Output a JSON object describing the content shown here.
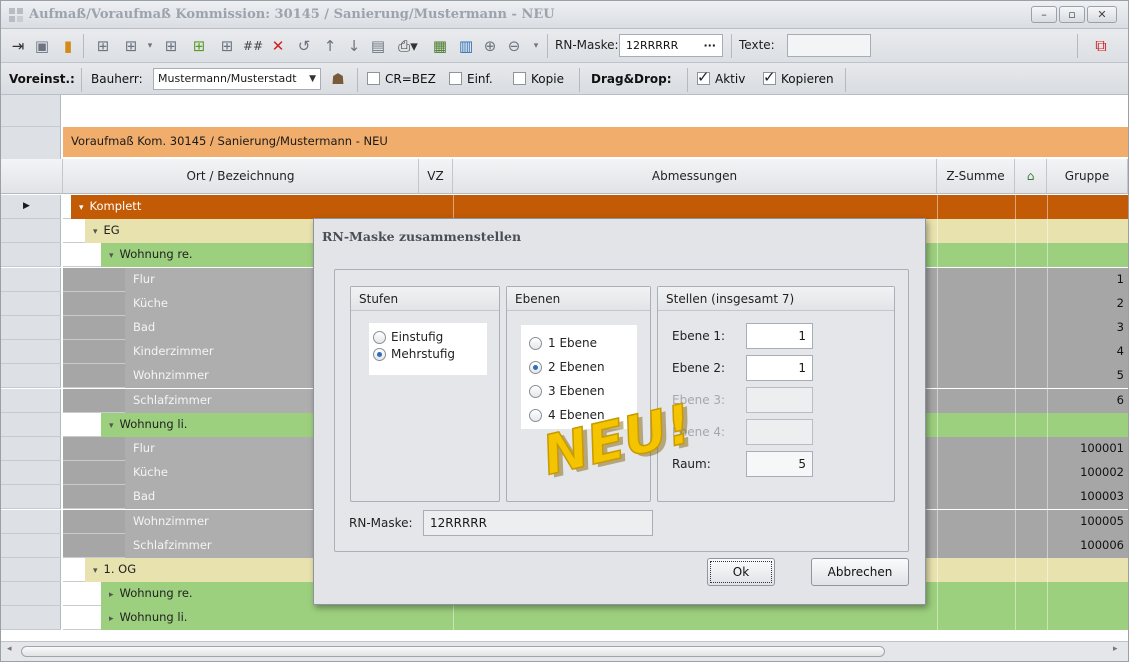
{
  "window": {
    "title": "Aufmaß/Voraufmaß Kommission: 30145 / Sanierung/Mustermann - NEU",
    "min": "–",
    "max": "▫",
    "close": "✕"
  },
  "toolbar": {
    "rn_label": "RN-Maske:",
    "rn_value": "12RRRRR",
    "rn_ellipsis": "···",
    "texte_label": "Texte:",
    "hash": "##"
  },
  "options": {
    "voreinst": "Voreinst.:",
    "bauherr_label": "Bauherr:",
    "bauherr_value": "Mustermann/Musterstadt",
    "cr_bez": "CR=BEZ",
    "einf": "Einf.",
    "kopie": "Kopie",
    "dragdrop": "Drag&Drop:",
    "aktiv": "Aktiv",
    "kopieren": "Kopieren"
  },
  "grid": {
    "caption": "Voraufmaß Kom. 30145 / Sanierung/Mustermann - NEU",
    "headers": {
      "ort": "Ort / Bezeichnung",
      "vz": "VZ",
      "abm": "Abmessungen",
      "zsum": "Z-Summe",
      "gruppe": "Gruppe"
    },
    "rows": [
      {
        "label": "Komplett",
        "exp": "▾",
        "gruppe": ""
      },
      {
        "label": "EG",
        "exp": "▾",
        "gruppe": ""
      },
      {
        "label": "Wohnung re.",
        "exp": "▾",
        "gruppe": ""
      },
      {
        "label": "Flur",
        "exp": "",
        "gruppe": "1"
      },
      {
        "label": "Küche",
        "exp": "",
        "gruppe": "2"
      },
      {
        "label": "Bad",
        "exp": "",
        "gruppe": "3"
      },
      {
        "label": "Kinderzimmer",
        "exp": "",
        "gruppe": "4"
      },
      {
        "label": "Wohnzimmer",
        "exp": "",
        "gruppe": "5"
      },
      {
        "label": "Schlafzimmer",
        "exp": "",
        "gruppe": "6"
      },
      {
        "label": "Wohnung li.",
        "exp": "▾",
        "gruppe": ""
      },
      {
        "label": "Flur",
        "exp": "",
        "gruppe": "100001"
      },
      {
        "label": "Küche",
        "exp": "",
        "gruppe": "100002"
      },
      {
        "label": "Bad",
        "exp": "",
        "gruppe": "100003"
      },
      {
        "label": "Wohnzimmer",
        "exp": "",
        "gruppe": "100005"
      },
      {
        "label": "Schlafzimmer",
        "exp": "",
        "gruppe": "100006"
      },
      {
        "label": "1. OG",
        "exp": "▾",
        "gruppe": ""
      },
      {
        "label": "Wohnung re.",
        "exp": "▸",
        "gruppe": ""
      },
      {
        "label": "Wohnung li.",
        "exp": "▸",
        "gruppe": ""
      }
    ]
  },
  "dialog": {
    "title": "RN-Maske zusammenstellen",
    "stufen": {
      "title": "Stufen",
      "einstufig": "Einstufig",
      "mehrstufig": "Mehrstufig"
    },
    "ebenen": {
      "title": "Ebenen",
      "e1": "1 Ebene",
      "e2": "2 Ebenen",
      "e3": "3 Ebenen",
      "e4": "4 Ebenen"
    },
    "stellen": {
      "title": "Stellen (insgesamt 7)",
      "ebene1": "Ebene 1:",
      "ebene1_val": "1",
      "ebene2": "Ebene 2:",
      "ebene2_val": "1",
      "ebene3": "Ebene 3:",
      "ebene4": "Ebene 4:",
      "raum": "Raum:",
      "raum_val": "5"
    },
    "rn_label": "RN-Maske:",
    "rn_value": "12RRRRR",
    "ok": "Ok",
    "abbrechen": "Abbrechen"
  },
  "badge": "NEU!",
  "colors": {
    "komplett": "#c25a06",
    "eg": "#e8e2ae",
    "wohnung": "#9ccf7e",
    "room": "#aeaeae",
    "caption": "#f1ad6c"
  }
}
